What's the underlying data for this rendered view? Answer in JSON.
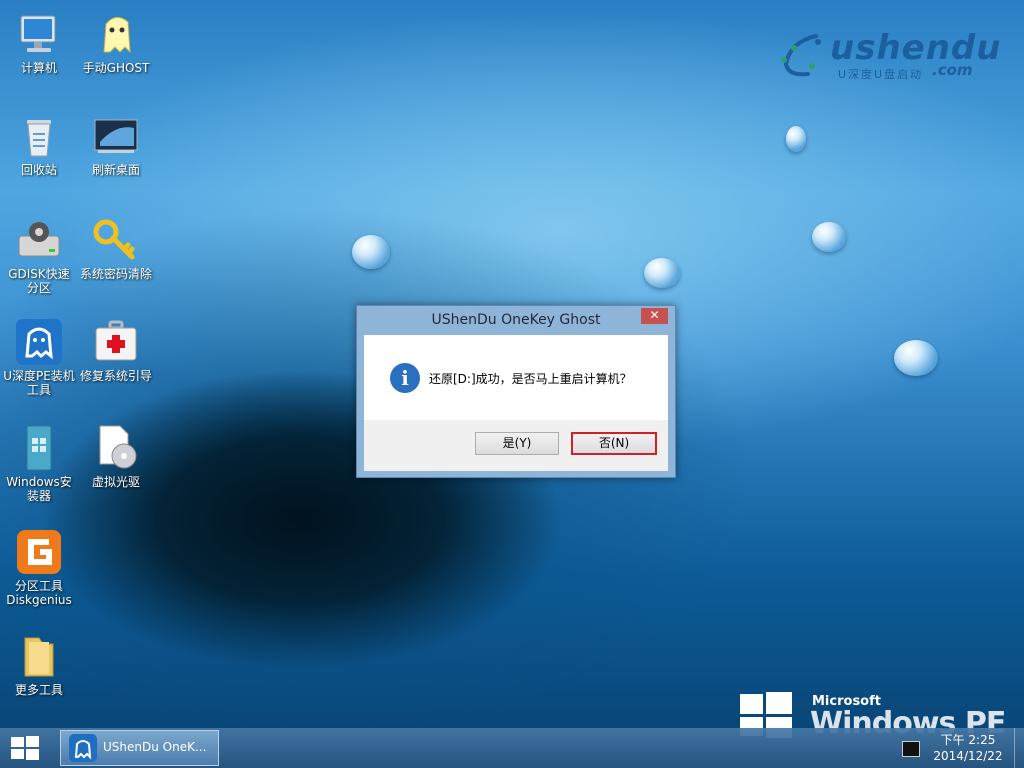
{
  "desktop": {
    "icons": [
      {
        "label": "计算机",
        "icon": "computer-icon"
      },
      {
        "label": "手动GHOST",
        "icon": "ghost-icon"
      },
      {
        "label": "回收站",
        "icon": "recycle-bin-icon"
      },
      {
        "label": "刷新桌面",
        "icon": "refresh-desktop-icon"
      },
      {
        "label": "GDISK快速分区",
        "icon": "gdisk-icon"
      },
      {
        "label": "系统密码清除",
        "icon": "key-icon"
      },
      {
        "label": "U深度PE装机工具",
        "icon": "ushendu-installer-icon"
      },
      {
        "label": "修复系统引导",
        "icon": "repair-kit-icon"
      },
      {
        "label": "Windows安装器",
        "icon": "windows-installer-icon"
      },
      {
        "label": "虚拟光驱",
        "icon": "virtual-drive-icon"
      },
      {
        "label": "分区工具Diskgenius",
        "icon": "diskgenius-icon"
      },
      {
        "label": "更多工具",
        "icon": "folder-icon"
      }
    ]
  },
  "branding": {
    "logo_text": "ushendu",
    "logo_sub": "U深度U盘启动",
    "logo_domain": ".com",
    "os_vendor": "Microsoft",
    "os_name": "Windows PE"
  },
  "dialog": {
    "title": "UShenDu OneKey Ghost",
    "close_glyph": "✕",
    "message": "还原[D:]成功，是否马上重启计算机？",
    "yes_label": "是(Y)",
    "no_label": "否(N)"
  },
  "taskbar": {
    "window_label": "UShenDu OneK...",
    "clock_time": "下午 2:25",
    "clock_date": "2014/12/22"
  },
  "colors": {
    "dialog_frame": "#8eb4d8",
    "no_button_border": "#d0202a",
    "taskbar": "#466ea5"
  }
}
